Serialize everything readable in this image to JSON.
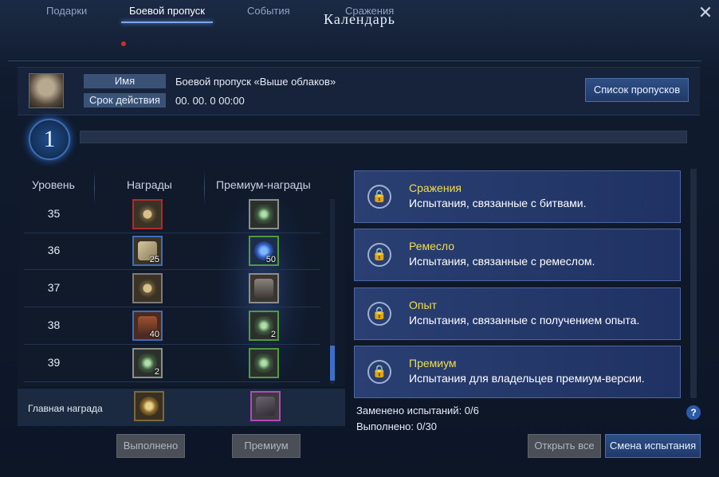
{
  "window": {
    "title": "Календарь",
    "close_symbol": "✕"
  },
  "tabs": [
    {
      "label": "Подарки"
    },
    {
      "label": "Боевой пропуск"
    },
    {
      "label": "События"
    },
    {
      "label": "Сражения"
    }
  ],
  "pass": {
    "name_label": "Имя",
    "name_value": "Боевой пропуск «Выше облаков»",
    "duration_label": "Срок действия",
    "duration_value": "00. 00. 0 00:00",
    "list_button": "Список пропусков"
  },
  "current_level": "1",
  "table": {
    "headers": [
      "Уровень",
      "Награды",
      "Премиум-награды"
    ],
    "rows": [
      {
        "level": "35",
        "reward_count": "",
        "premium_count": ""
      },
      {
        "level": "36",
        "reward_count": "25",
        "premium_count": "50"
      },
      {
        "level": "37",
        "reward_count": "",
        "premium_count": ""
      },
      {
        "level": "38",
        "reward_count": "40",
        "premium_count": "2"
      },
      {
        "level": "39",
        "reward_count": "2",
        "premium_count": ""
      }
    ],
    "main_reward_label": "Главная награда"
  },
  "challenges": [
    {
      "title": "Сражения",
      "desc": "Испытания, связанные с битвами."
    },
    {
      "title": "Ремесло",
      "desc": "Испытания, связанные с ремеслом."
    },
    {
      "title": "Опыт",
      "desc": "Испытания, связанные с получением опыта."
    },
    {
      "title": "Премиум",
      "desc": "Испытания для владельцев премиум-версии."
    }
  ],
  "stats": {
    "replaced": "Заменено испытаний: 0/6",
    "done": "Выполнено: 0/30"
  },
  "buttons": {
    "completed": "Выполнено",
    "premium": "Премиум",
    "open_all": "Открыть все",
    "change_challenge": "Смена испытания",
    "help": "?"
  },
  "colors": {
    "accent": "#3d6ec9",
    "card_title": "#f1df4c",
    "notify_dot": "#d82a2a"
  }
}
